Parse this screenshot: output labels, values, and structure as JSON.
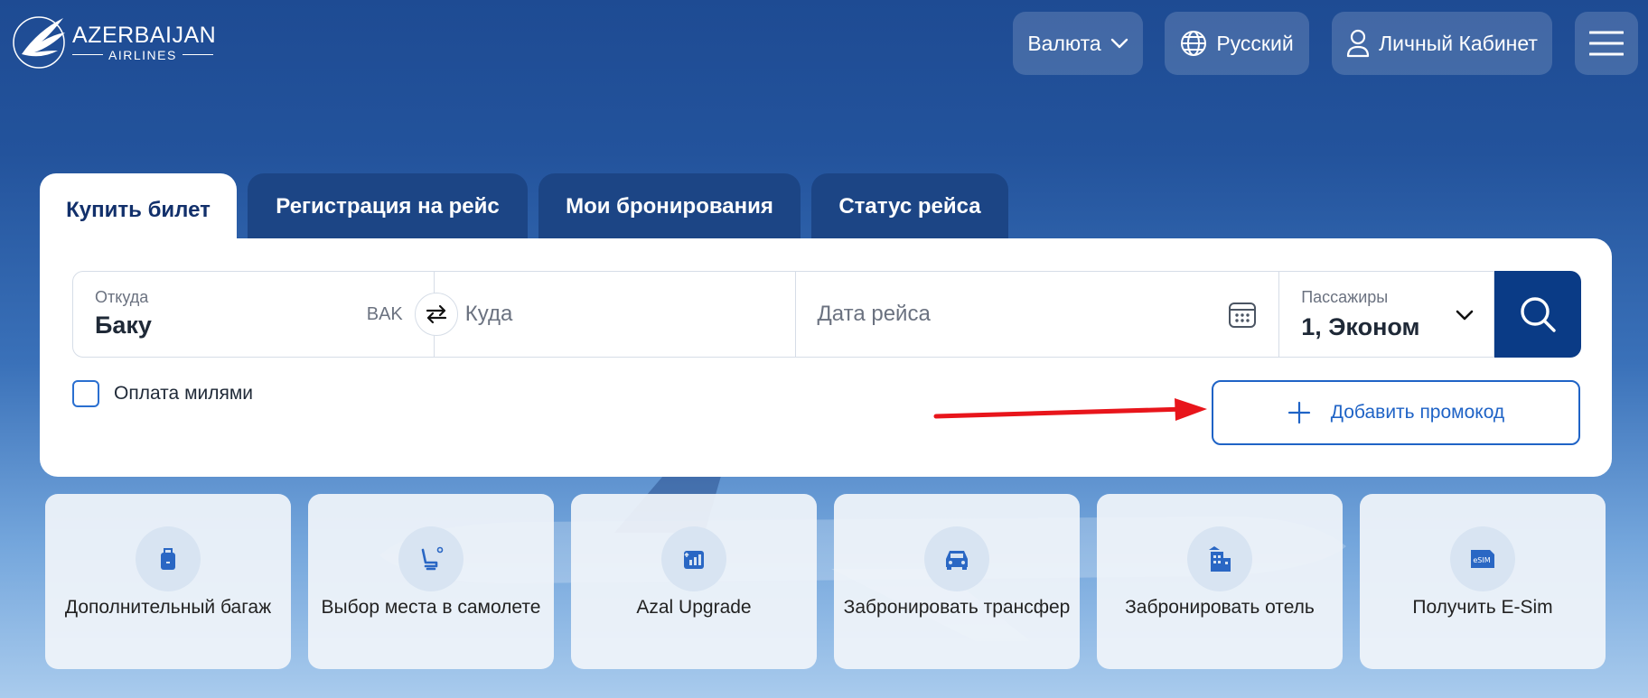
{
  "brand": {
    "name": "AZERBAIJAN",
    "sub": "AIRLINES"
  },
  "header": {
    "currency_label": "Валюта",
    "language_label": "Русский",
    "account_label": "Личный Кабинет"
  },
  "tabs": [
    {
      "label": "Купить билет",
      "active": true
    },
    {
      "label": "Регистрация на рейс",
      "active": false
    },
    {
      "label": "Мои бронирования",
      "active": false
    },
    {
      "label": "Статус рейса",
      "active": false
    }
  ],
  "search": {
    "from_label": "Откуда",
    "from_value": "Баку",
    "from_code": "BAK",
    "to_placeholder": "Куда",
    "date_placeholder": "Дата рейса",
    "passengers_label": "Пассажиры",
    "passengers_value": "1, Эконом",
    "pay_miles_label": "Оплата милями",
    "promo_label": "Добавить промокод"
  },
  "services": [
    {
      "label": "Дополнительный багаж",
      "icon": "luggage-icon"
    },
    {
      "label": "Выбор места в самолете",
      "icon": "seat-icon"
    },
    {
      "label": "Azal Upgrade",
      "icon": "upgrade-icon"
    },
    {
      "label": "Забронировать трансфер",
      "icon": "car-icon"
    },
    {
      "label": "Забронировать отель",
      "icon": "hotel-icon"
    },
    {
      "label": "Получить E-Sim",
      "icon": "esim-icon"
    }
  ],
  "colors": {
    "primary": "#0a3b86",
    "tab_inactive": "#1c4585",
    "link": "#1f63c6",
    "annotation_arrow": "#e8151b"
  }
}
